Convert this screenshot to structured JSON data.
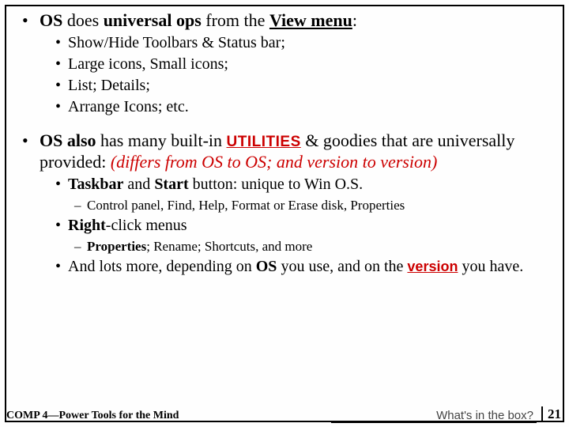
{
  "l1a": {
    "os": "OS",
    "mid": " does ",
    "ops": "universal ops",
    "from": " from the ",
    "vm": "View menu",
    "colon": ":"
  },
  "l2a": "Show/Hide Toolbars & Status bar;",
  "l2b": "Large icons, Small icons;",
  "l2c": "List; Details;",
  "l2d": "Arrange Icons; etc.",
  "l1b": {
    "os": "OS also",
    "mid": " has many built-in ",
    "util": "UTILITIES",
    "rest": " & goodies that are universally provided: ",
    "red": "(differs from OS to OS; and version to version)"
  },
  "l2e": {
    "a": "Taskbar",
    "b": " and ",
    "c": "Start",
    "d": " button:  unique to Win O.S."
  },
  "l3a": "Control panel, Find, Help, Format or Erase disk, Properties",
  "l2f": {
    "a": "Right",
    "b": "-click menus"
  },
  "l3b": {
    "a": "Properties",
    "b": "; Rename; Shortcuts, and more"
  },
  "l2g": {
    "a": "And lots more, depending on ",
    "b": "OS",
    "c": " you use, and on the ",
    "d": "version",
    "e": " you have."
  },
  "footer": {
    "left": "COMP 4—Power Tools for the Mind",
    "center": "What's in the box?",
    "page": "21"
  }
}
